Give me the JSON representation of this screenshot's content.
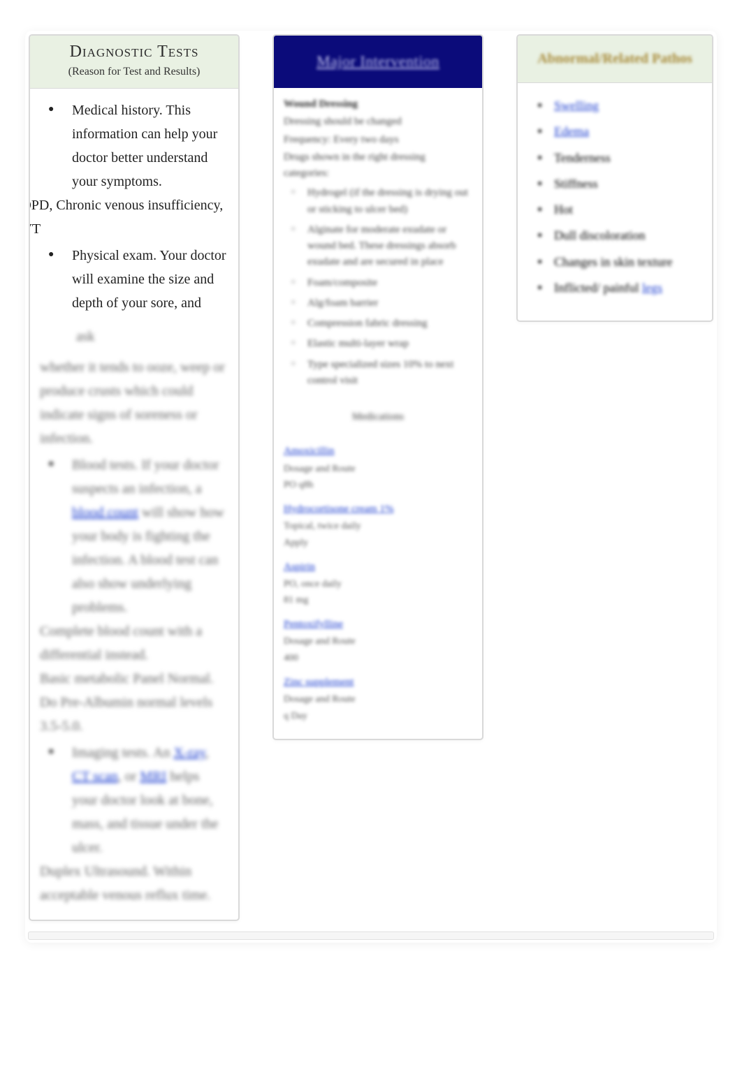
{
  "col1": {
    "title": "Diagnostic Tests",
    "subtitle": "(Reason for Test and Results)",
    "items_top": [
      "Medical history. This information can help your doctor better understand your symptoms."
    ],
    "interject_1": "COPD, Chronic venous insufficiency, DVT",
    "items_mid": [
      "Physical exam. Your doctor will examine the size and depth of your sore, and"
    ],
    "short_line": "ask",
    "para_1": "whether it tends to ooze, weep or produce crusts which could indicate signs of soreness or infection.",
    "items_blur": [
      "Blood tests. If your doctor suspects an infection, a blood count will show how your body is fighting the infection. A blood test can also show underlying problems."
    ],
    "para_2": "Complete blood count with a differential instead.",
    "para_3": "Basic metabolic Panel Normal.",
    "para_4": "Do Pre-Albumin normal levels 3.5-5.0.",
    "items_blur2": [
      "Imaging tests. An X-ray, CT scan, or MRI helps your doctor look at bone, mass, and tissue under the ulcer."
    ],
    "para_5": "Duplex Ultrasound. Within acceptable venous reflux time.",
    "link_blood": "blood count",
    "link_xray": "X-ray",
    "link_ct": "CT scan",
    "link_mri": "MRI"
  },
  "col2": {
    "title": "Major Intervention",
    "head1": "Wound Dressing",
    "l1": "Dressing should be changed",
    "l2": "Frequency: Every two days",
    "l3": "Drugs shown in the right dressing categories:",
    "bullets": [
      "Hydrogel (if the dressing is drying out or sticking to ulcer bed)",
      "Alginate for moderate exudate or wound bed. These dressings absorb exudate and are secured in place",
      "Foam/composite",
      "Alg/foam barrier",
      "Compression fabric dressing",
      "Elastic multi-layer wrap",
      "Type specialized sizes 10% to next control visit"
    ],
    "mid_header": "Medications",
    "meds": [
      {
        "name": "Amoxicillin",
        "line1": "Dosage and Route",
        "line2": "PO q8h"
      },
      {
        "name": "Hydrocortisone cream 1%",
        "line1": "Topical, twice daily",
        "line2": "Apply"
      },
      {
        "name": "Aspirin",
        "line1": "PO, once daily",
        "line2": "81 mg"
      },
      {
        "name": "Pentoxifylline",
        "line1": "Dosage and Route",
        "line2": "400"
      },
      {
        "name": "Zinc supplement",
        "line1": "Dosage and Route",
        "line2": "q Day"
      }
    ]
  },
  "col3": {
    "title": "Abnormal/Related Pathos",
    "bullets": [
      {
        "text": "Swelling",
        "link": true
      },
      {
        "text": "Edema",
        "link": true
      },
      {
        "text": "Tenderness",
        "link": false
      },
      {
        "text": "Stiffness",
        "link": false
      },
      {
        "text": "Hot",
        "link": false
      },
      {
        "text": "Dull discoloration",
        "link": false
      },
      {
        "text": "Changes in skin texture",
        "link": false
      },
      {
        "text": "Inflicted/ painful legs",
        "link_tail": "legs"
      }
    ]
  }
}
